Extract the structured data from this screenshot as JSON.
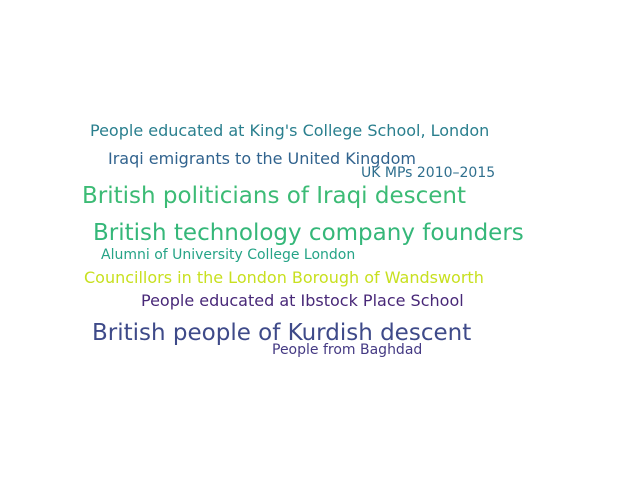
{
  "words": [
    {
      "text": "People educated at King's College School, London",
      "color": "#2a7f8e"
    },
    {
      "text": "Iraqi emigrants to the United Kingdom",
      "color": "#31638e"
    },
    {
      "text": "UK MPs 2010–2015",
      "color": "#2f6f8e"
    },
    {
      "text": "British politicians of Iraqi descent",
      "color": "#3cbb75"
    },
    {
      "text": "British technology company founders",
      "color": "#35b779"
    },
    {
      "text": "Alumni of University College London",
      "color": "#25a386"
    },
    {
      "text": "Councillors in the London Borough of Wandsworth",
      "color": "#c8e020"
    },
    {
      "text": "People educated at Ibstock Place School",
      "color": "#482878"
    },
    {
      "text": "British people of Kurdish descent",
      "color": "#3e4a89"
    },
    {
      "text": "People from Baghdad",
      "color": "#443983"
    }
  ]
}
